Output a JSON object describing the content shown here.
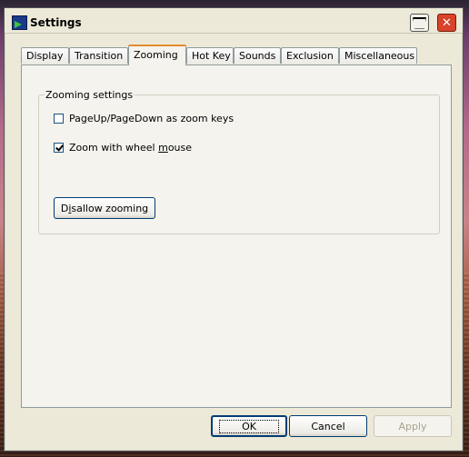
{
  "window": {
    "title": "Settings",
    "controls": {
      "minimize_icon": "minimize-icon",
      "close_label": "✕"
    }
  },
  "tabs": [
    {
      "label": "Display"
    },
    {
      "label": "Transition"
    },
    {
      "label": "Zooming",
      "active": true
    },
    {
      "label": "Hot Key"
    },
    {
      "label": "Sounds"
    },
    {
      "label": "Exclusion"
    },
    {
      "label": "Miscellaneous"
    }
  ],
  "zooming": {
    "group_title": "Zooming settings",
    "options": [
      {
        "label": "PageUp/PageDown as zoom keys",
        "checked": false
      },
      {
        "label_pre": "Zoom with wheel ",
        "label_key": "m",
        "label_post": "ouse",
        "checked": true
      }
    ],
    "disallow_pre": "D",
    "disallow_key": "i",
    "disallow_post": "sallow zooming"
  },
  "footer": {
    "ok_label": "OK",
    "cancel_label": "Cancel",
    "apply_label": "Apply",
    "apply_enabled": false
  },
  "colors": {
    "dialog_bg": "#ece9d8",
    "active_tab_accent": "#e68b2c",
    "close_button": "#d8432a",
    "button_border": "#003c74"
  }
}
